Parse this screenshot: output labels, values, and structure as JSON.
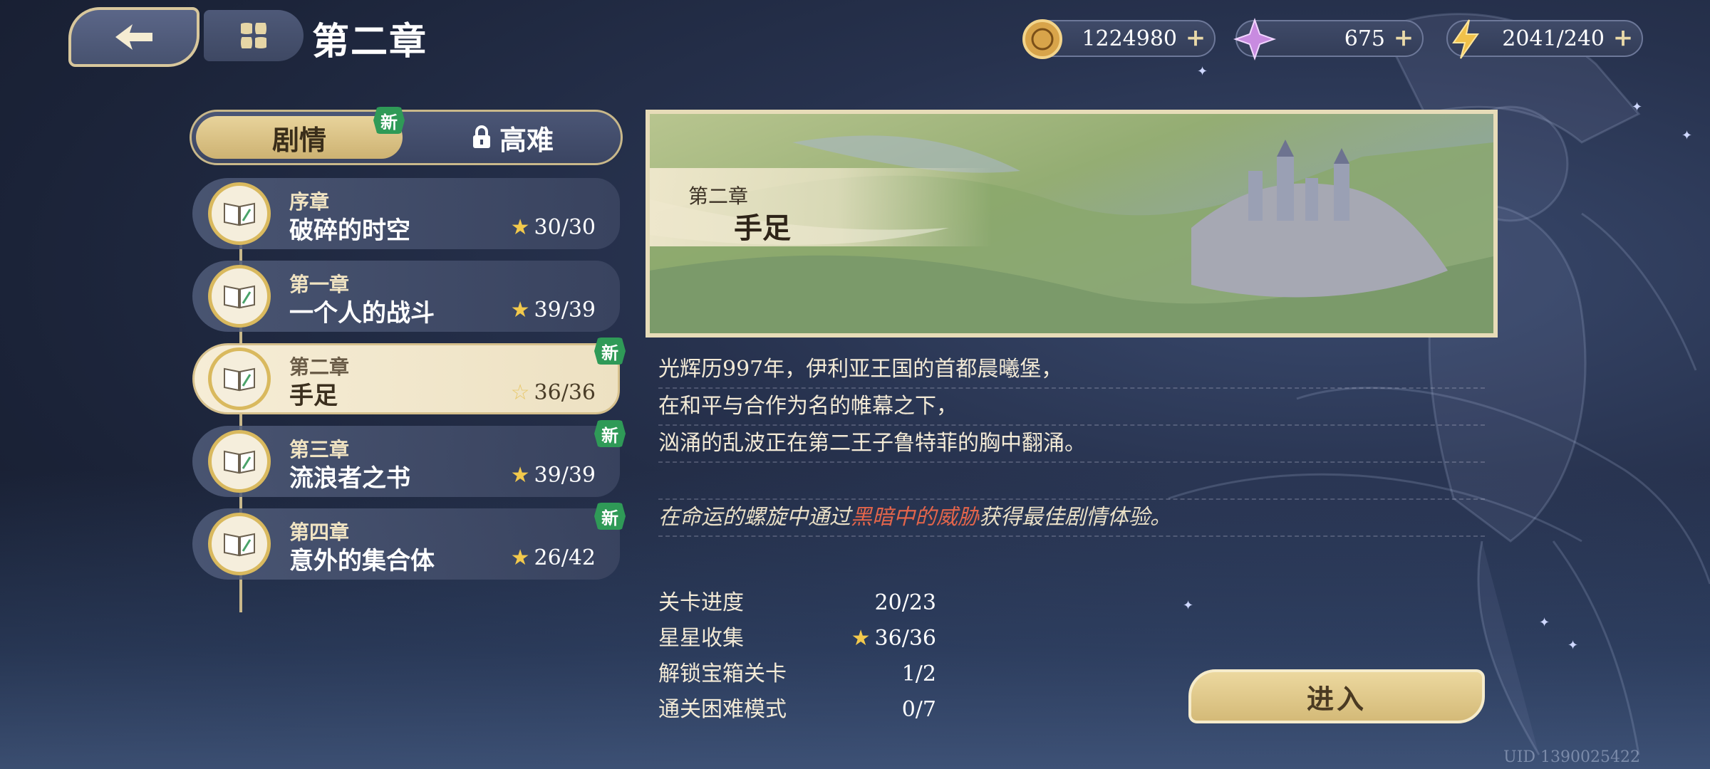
{
  "header": {
    "title": "第二章",
    "back_icon": "back-arrow-icon",
    "menu_icon": "four-petal-menu-icon"
  },
  "currencies": [
    {
      "name": "gold-coin",
      "value": "1224980",
      "icon": "coin-icon"
    },
    {
      "name": "crystal",
      "value": "675",
      "icon": "crystal-icon"
    },
    {
      "name": "stamina",
      "value": "2041/240",
      "icon": "lightning-icon"
    }
  ],
  "tabs": {
    "story": "剧情",
    "hard": "高难",
    "new_badge": "新"
  },
  "chapters": [
    {
      "sub": "序章",
      "name": "破碎的时空",
      "stars": "30/30",
      "new": false,
      "active": false
    },
    {
      "sub": "第一章",
      "name": "一个人的战斗",
      "stars": "39/39",
      "new": false,
      "active": false
    },
    {
      "sub": "第二章",
      "name": "手足",
      "stars": "36/36",
      "new": true,
      "active": true
    },
    {
      "sub": "第三章",
      "name": "流浪者之书",
      "stars": "39/39",
      "new": true,
      "active": false
    },
    {
      "sub": "第四章",
      "name": "意外的集合体",
      "stars": "26/42",
      "new": true,
      "active": false
    }
  ],
  "new_badge": "新",
  "banner": {
    "chapter": "第二章",
    "title": "手足"
  },
  "description": {
    "lines": [
      "光辉历997年，伊利亚王国的首都晨曦堡，",
      "在和平与合作为名的帷幕之下，",
      "汹涌的乱波正在第二王子鲁特菲的胸中翻涌。"
    ],
    "hint_prefix": "在命运的螺旋中通过",
    "hint_highlight": "黑暗中的威胁",
    "hint_suffix": "获得最佳剧情体验。"
  },
  "stats": [
    {
      "label": "关卡进度",
      "value": "20/23"
    },
    {
      "label": "星星收集",
      "value": "36/36"
    },
    {
      "label": "解锁宝箱关卡",
      "value": "1/2"
    },
    {
      "label": "通关困难模式",
      "value": "0/7"
    }
  ],
  "enter_button": "进入",
  "uid": "UID 1390025422",
  "colors": {
    "accent_gold": "#d9b95e",
    "new_badge": "#2f9a57",
    "highlight_red": "#e3654b"
  }
}
